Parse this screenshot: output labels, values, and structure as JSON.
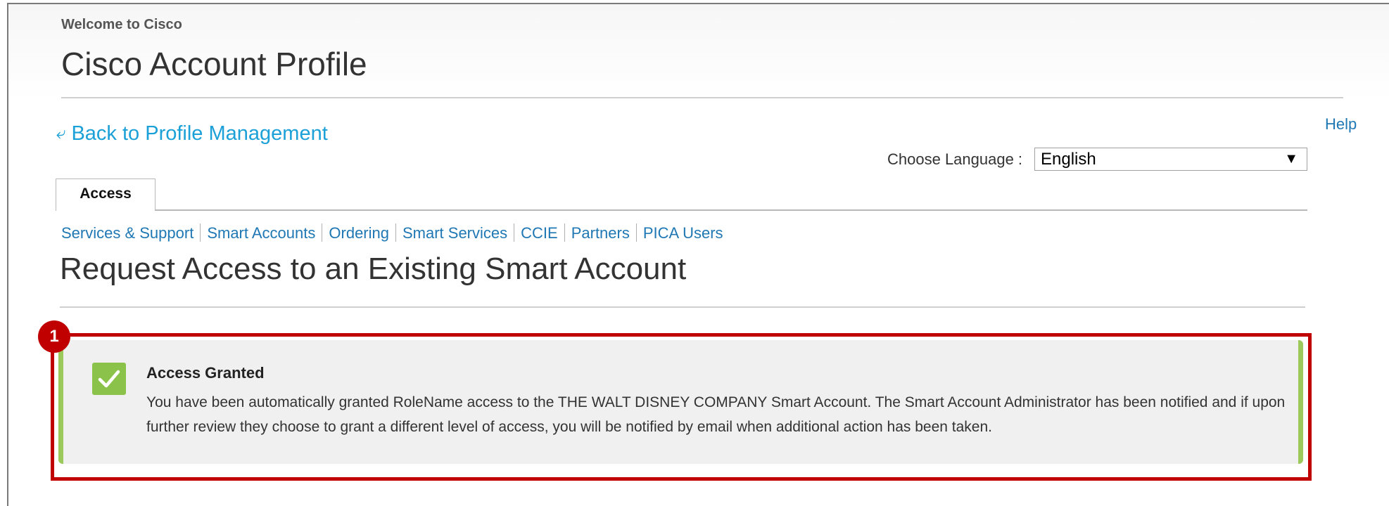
{
  "header": {
    "welcome": "Welcome to Cisco",
    "title": "Cisco Account Profile"
  },
  "nav": {
    "back_label": "Back to Profile Management",
    "help_label": "Help"
  },
  "language": {
    "label": "Choose Language :",
    "selected": "English"
  },
  "tabs": [
    {
      "label": "Access",
      "active": true
    }
  ],
  "subnav": [
    {
      "label": "Services & Support"
    },
    {
      "label": "Smart Accounts"
    },
    {
      "label": "Ordering"
    },
    {
      "label": "Smart Services"
    },
    {
      "label": "CCIE"
    },
    {
      "label": "Partners"
    },
    {
      "label": "PICA Users"
    }
  ],
  "section": {
    "title": "Request Access to an Existing Smart Account"
  },
  "callout": {
    "number": "1"
  },
  "alert": {
    "title": "Access Granted",
    "body": "You have been automatically granted RoleName access to the THE WALT DISNEY COMPANY Smart Account. The Smart Account Administrator has been notified and if upon further review they choose to grant a different level of access, you will be notified by email when additional action has been taken."
  },
  "colors": {
    "link": "#1f78b4",
    "back_link": "#1ba0d7",
    "success": "#8bc34a",
    "callout": "#c00000"
  }
}
